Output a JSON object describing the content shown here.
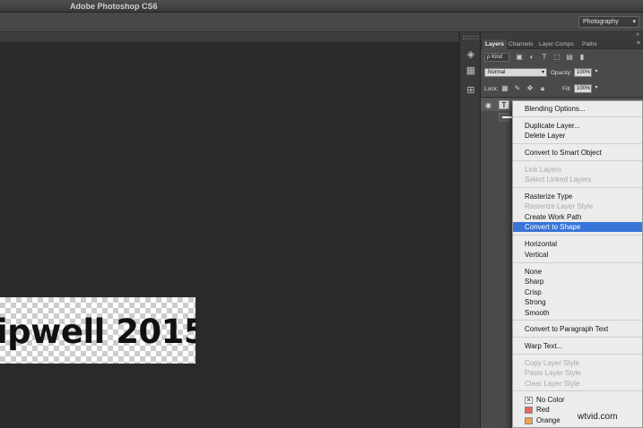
{
  "app": {
    "title": "Adobe Photoshop CS6"
  },
  "options_bar": {
    "workspace": "Photography"
  },
  "canvas": {
    "visible_text": "ipwell 2015"
  },
  "layers_panel": {
    "tabs": [
      "Layers",
      "Channels",
      "Layer Comps",
      "Paths"
    ],
    "active_tab": "Layers",
    "filter_kind": "ρ Kind",
    "blend_mode": "Normal",
    "opacity_label": "Opacity:",
    "opacity_value": "100%",
    "lock_label": "Lock:",
    "fill_label": "Fill:",
    "fill_value": "100%"
  },
  "context_menu": {
    "items": [
      {
        "label": "Blending Options...",
        "enabled": true
      },
      {
        "label": "Duplicate Layer...",
        "enabled": true
      },
      {
        "label": "Delete Layer",
        "enabled": true
      },
      {
        "label": "Convert to Smart Object",
        "enabled": true
      },
      {
        "label": "Link Layers",
        "enabled": false
      },
      {
        "label": "Select Linked Layers",
        "enabled": false
      },
      {
        "label": "Rasterize Type",
        "enabled": true
      },
      {
        "label": "Rasterize Layer Style",
        "enabled": false
      },
      {
        "label": "Create Work Path",
        "enabled": true
      },
      {
        "label": "Convert to Shape",
        "enabled": true,
        "selected": true
      },
      {
        "label": "Horizontal",
        "enabled": true
      },
      {
        "label": "Vertical",
        "enabled": true
      },
      {
        "label": "None",
        "enabled": true
      },
      {
        "label": "Sharp",
        "enabled": true
      },
      {
        "label": "Crisp",
        "enabled": true
      },
      {
        "label": "Strong",
        "enabled": true
      },
      {
        "label": "Smooth",
        "enabled": true
      },
      {
        "label": "Convert to Paragraph Text",
        "enabled": true
      },
      {
        "label": "Warp Text...",
        "enabled": true
      },
      {
        "label": "Copy Layer Style",
        "enabled": false
      },
      {
        "label": "Paste Layer Style",
        "enabled": false
      },
      {
        "label": "Clear Layer Style",
        "enabled": false
      }
    ],
    "colors": [
      {
        "label": "No Color",
        "swatch": "#ffffff"
      },
      {
        "label": "Red",
        "swatch": "#e8665e"
      },
      {
        "label": "Orange",
        "swatch": "#f0a050"
      }
    ]
  },
  "watermark": "wtvid.com"
}
